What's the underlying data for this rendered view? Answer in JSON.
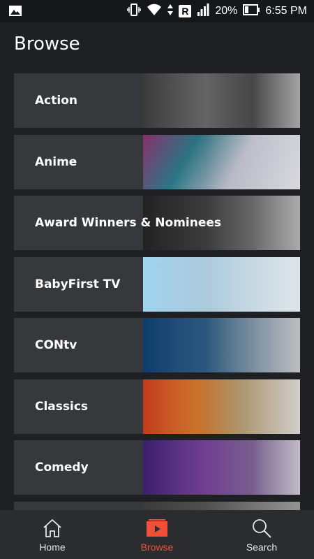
{
  "status": {
    "battery": "20%",
    "time": "6:55 PM",
    "carrier_badge": "R"
  },
  "page": {
    "title": "Browse"
  },
  "categories": [
    {
      "label": "Action"
    },
    {
      "label": "Anime"
    },
    {
      "label": "Award Winners & Nominees"
    },
    {
      "label": "BabyFirst TV"
    },
    {
      "label": "CONtv"
    },
    {
      "label": "Classics"
    },
    {
      "label": "Comedy"
    },
    {
      "label": ""
    }
  ],
  "nav": {
    "home": "Home",
    "browse": "Browse",
    "search": "Search"
  },
  "colors": {
    "accent": "#f0503a",
    "background": "#1f2023",
    "card": "#37383b"
  }
}
